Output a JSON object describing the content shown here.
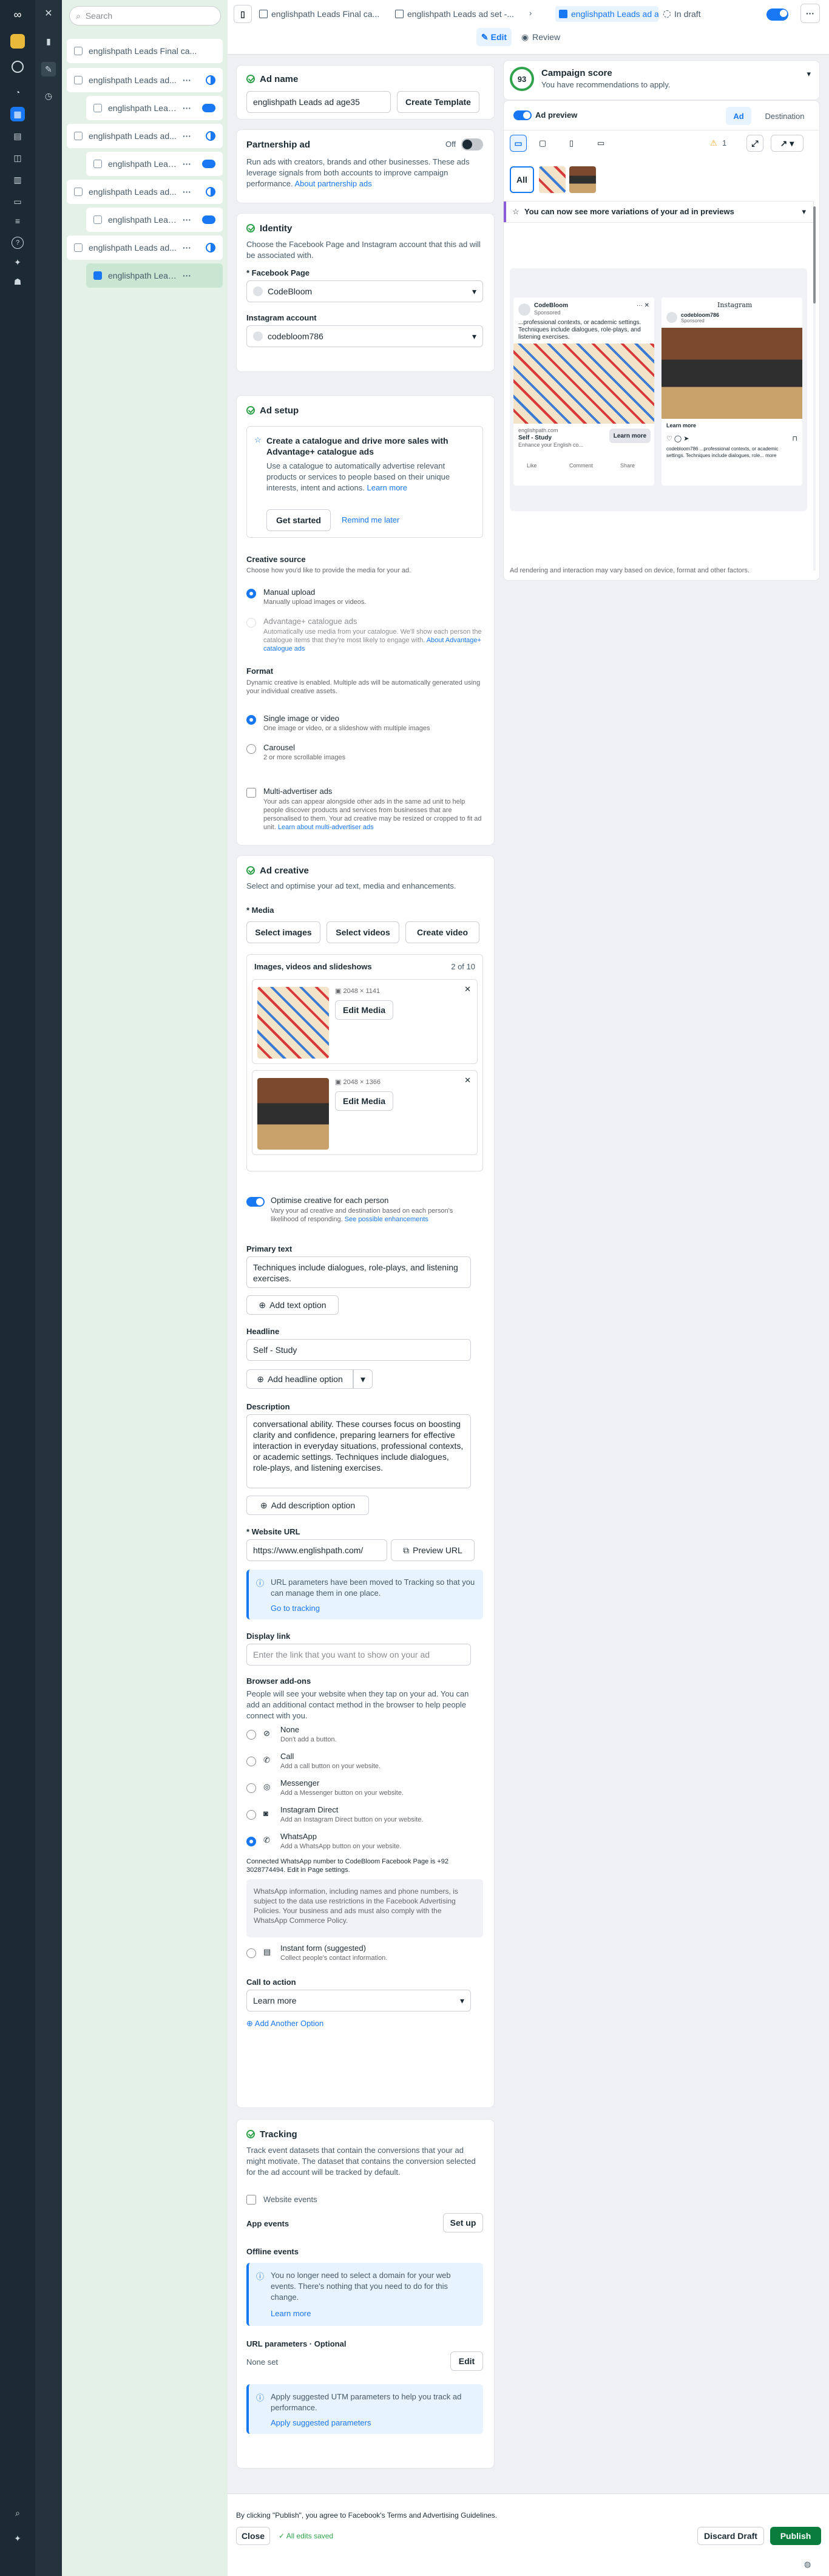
{
  "search": {
    "placeholder": "Search"
  },
  "tree": [
    {
      "label": "englishpath Leads Final ca..."
    },
    {
      "label": "englishpath Leads ad..."
    },
    {
      "label": "englishpath Leads ad"
    },
    {
      "label": "englishpath Leads ad..."
    },
    {
      "label": "englishpath Leads ad..."
    },
    {
      "label": "englishpath Leads ad..."
    },
    {
      "label": "englishpath Leads ad..."
    },
    {
      "label": "englishpath Leads ad..."
    },
    {
      "label": "englishpath Leads ad..."
    }
  ],
  "breadcrumb": {
    "campaign": "englishpath Leads Final ca...",
    "adset": "englishpath Leads ad set -...",
    "ad": "englishpath Leads ad age35",
    "status": "In draft"
  },
  "header": {
    "edit": "Edit",
    "review": "Review"
  },
  "adname": {
    "title": "Ad name",
    "value": "englishpath Leads ad age35",
    "create_template": "Create Template"
  },
  "partnership": {
    "title": "Partnership ad",
    "state": "Off",
    "desc": "Run ads with creators, brands and other businesses. These ads leverage signals from both accounts to improve campaign performance.",
    "link": "About partnership ads"
  },
  "identity": {
    "title": "Identity",
    "desc": "Choose the Facebook Page and Instagram account that this ad will be associated with.",
    "fb_label": "* Facebook Page",
    "fb_value": "CodeBloom",
    "ig_label": "Instagram account",
    "ig_value": "codebloom786"
  },
  "setup": {
    "title": "Ad setup",
    "promo_title": "Create a catalogue and drive more sales with Advantage+ catalogue ads",
    "promo_desc": "Use a catalogue to automatically advertise relevant products or services to people based on their unique interests, intent and actions.",
    "promo_link": "Learn more",
    "get_started": "Get started",
    "remind": "Remind me later",
    "source_title": "Creative source",
    "source_desc": "Choose how you'd like to provide the media for your ad.",
    "manual": "Manual upload",
    "manual_desc": "Manually upload images or videos.",
    "adv": "Advantage+ catalogue ads",
    "adv_desc": "Automatically use media from your catalogue. We'll show each person the catalogue items that they're most likely to engage with.",
    "adv_link": "About Advantage+ catalogue ads",
    "format_title": "Format",
    "format_desc": "Dynamic creative is enabled. Multiple ads will be automatically generated using your individual creative assets.",
    "single": "Single image or video",
    "single_desc": "One image or video, or a slideshow with multiple images",
    "carousel": "Carousel",
    "carousel_desc": "2 or more scrollable images",
    "multi": "Multi-advertiser ads",
    "multi_desc": "Your ads can appear alongside other ads in the same ad unit to help people discover products and services from businesses that are personalised to them. Your ad creative may be resized or cropped to fit ad unit.",
    "multi_link": "Learn about multi-advertiser ads"
  },
  "creative": {
    "title": "Ad creative",
    "desc": "Select and optimise your ad text, media and enhancements.",
    "media_label": "* Media",
    "select_images": "Select images",
    "select_videos": "Select videos",
    "create_video": "Create video",
    "box_title": "Images, videos and slideshows",
    "count": "2 of 10",
    "img1_size": "2048 × 1141",
    "img2_size": "2048 × 1366",
    "edit_media": "Edit Media",
    "optimise": "Optimise creative for each person",
    "optimise_desc": "Vary your ad creative and destination based on each person's likelihood of responding.",
    "optimise_link": "See possible enhancements",
    "primary_label": "Primary text",
    "primary_value": "Techniques include dialogues, role-plays, and listening exercises.",
    "add_text": "Add text option",
    "headline_label": "Headline",
    "headline_value": "Self - Study",
    "add_headline": "Add headline option",
    "desc_label": "Description",
    "desc_value": "conversational ability. These courses focus on boosting clarity and confidence, preparing learners for effective interaction in everyday situations, professional contexts, or academic settings. Techniques include dialogues, role-plays, and listening exercises.",
    "add_desc": "Add description option",
    "url_label": "* Website URL",
    "url_value": "https://www.englishpath.com/",
    "preview_url": "Preview URL",
    "url_info": "URL parameters have been moved to Tracking so that you can manage them in one place.",
    "go_tracking": "Go to tracking",
    "display_label": "Display link",
    "display_placeholder": "Enter the link that you want to show on your ad",
    "addons_title": "Browser add-ons",
    "addons_desc": "People will see your website when they tap on your ad. You can add an additional contact method in the browser to help people connect with you.",
    "addons": [
      {
        "name": "None",
        "desc": "Don't add a button."
      },
      {
        "name": "Call",
        "desc": "Add a call button on your website."
      },
      {
        "name": "Messenger",
        "desc": "Add a Messenger button on your website."
      },
      {
        "name": "Instagram Direct",
        "desc": "Add an Instagram Direct button on your website."
      },
      {
        "name": "WhatsApp",
        "desc": "Add a WhatsApp button on your website."
      }
    ],
    "wa_connected": "Connected WhatsApp number to CodeBloom Facebook Page is +92 3028774494. Edit in Page settings.",
    "wa_info": "WhatsApp information, including names and phone numbers, is subject to the data use restrictions in the Facebook Advertising Policies. Your business and ads must also comply with the WhatsApp Commerce Policy.",
    "instant": "Instant form (suggested)",
    "instant_desc": "Collect people's contact information.",
    "cta_label": "Call to action",
    "cta_value": "Learn more",
    "add_option": "Add Another Option"
  },
  "tracking": {
    "title": "Tracking",
    "desc": "Track event datasets that contain the conversions that your ad might motivate. The dataset that contains the conversion selected for the ad account will be tracked by default.",
    "website": "Website events",
    "app": "App events",
    "setup": "Set up",
    "offline": "Offline events",
    "offline_info": "You no longer need to select a domain for your web events. There's nothing that you need to do for this change.",
    "learn_more": "Learn more",
    "url_params": "URL parameters · Optional",
    "none_set": "None set",
    "edit": "Edit",
    "utm_info": "Apply suggested UTM parameters to help you track ad performance.",
    "utm_link": "Apply suggested parameters"
  },
  "score": {
    "value": "93",
    "title": "Campaign score",
    "desc": "You have recommendations to apply."
  },
  "preview": {
    "title": "Ad preview",
    "tab_ad": "Ad",
    "tab_dest": "Destination",
    "all": "All",
    "warn_count": "1",
    "banner": "You can now see more variations of your ad in previews",
    "fb_name": "CodeBloom",
    "fb_sub": "Sponsored",
    "fb_text": "...professional contexts, or academic settings. Techniques include dialogues, role-plays, and listening exercises.",
    "fb_domain": "englishpath.com",
    "fb_head": "Self - Study",
    "fb_desc": "Enhance your English co...",
    "fb_cta": "Learn more",
    "like": "Like",
    "comment": "Comment",
    "share": "Share",
    "ig_brand": "Instagram",
    "ig_name": "codebloom786",
    "ig_sub": "Sponsored",
    "ig_cta": "Learn more",
    "ig_caption": "codebloom786 ...professional contexts, or academic settings. Techniques include dialogues, role... more",
    "footnote": "Ad rendering and interaction may vary based on device, format and other factors."
  },
  "footer": {
    "terms": "By clicking \"Publish\", you agree to Facebook's Terms and Advertising Guidelines.",
    "close": "Close",
    "saved": "All edits saved",
    "discard": "Discard Draft",
    "publish": "Publish"
  },
  "colors": {
    "accent": "#1877f2",
    "publish": "#0a7c3c",
    "sidebar": "#1c2b33"
  }
}
